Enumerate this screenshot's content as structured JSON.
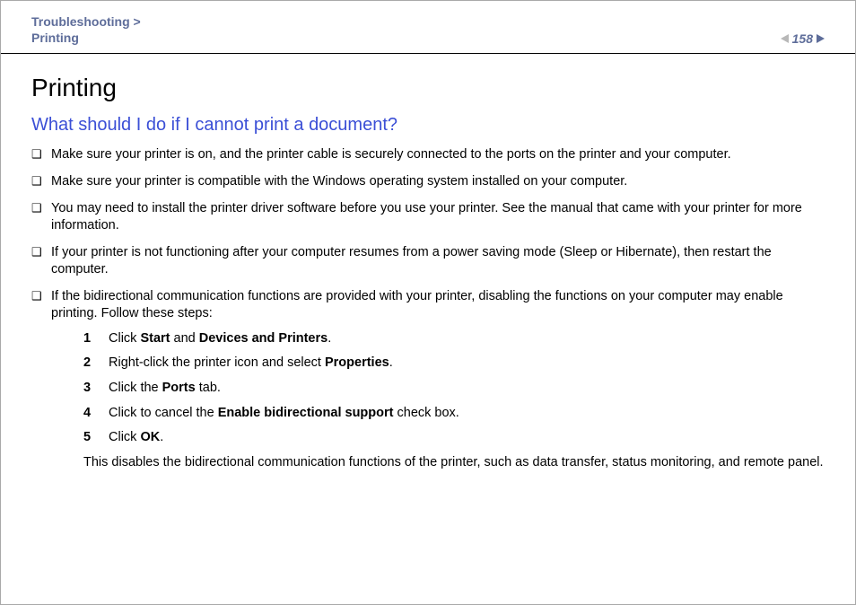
{
  "breadcrumb": {
    "line1": "Troubleshooting >",
    "line2": "Printing"
  },
  "page_number": "158",
  "title": "Printing",
  "question": "What should I do if I cannot print a document?",
  "bullets": [
    "Make sure your printer is on, and the printer cable is securely connected to the ports on the printer and your computer.",
    "Make sure your printer is compatible with the Windows operating system installed on your computer.",
    "You may need to install the printer driver software before you use your printer. See the manual that came with your printer for more information.",
    "If your printer is not functioning after your computer resumes from a power saving mode (Sleep or Hibernate), then restart the computer.",
    "If the bidirectional communication functions are provided with your printer, disabling the functions on your computer may enable printing. Follow these steps:"
  ],
  "steps": [
    {
      "n": "1",
      "pre": "Click ",
      "b1": "Start",
      "mid": " and ",
      "b2": "Devices and Printers",
      "post": "."
    },
    {
      "n": "2",
      "pre": "Right-click the printer icon and select ",
      "b1": "Properties",
      "mid": "",
      "b2": "",
      "post": "."
    },
    {
      "n": "3",
      "pre": "Click the ",
      "b1": "Ports",
      "mid": "",
      "b2": "",
      "post": " tab."
    },
    {
      "n": "4",
      "pre": "Click to cancel the ",
      "b1": "Enable bidirectional support",
      "mid": "",
      "b2": "",
      "post": " check box."
    },
    {
      "n": "5",
      "pre": "Click ",
      "b1": "OK",
      "mid": "",
      "b2": "",
      "post": "."
    }
  ],
  "after_steps": "This disables the bidirectional communication functions of the printer, such as data transfer, status monitoring, and remote panel."
}
